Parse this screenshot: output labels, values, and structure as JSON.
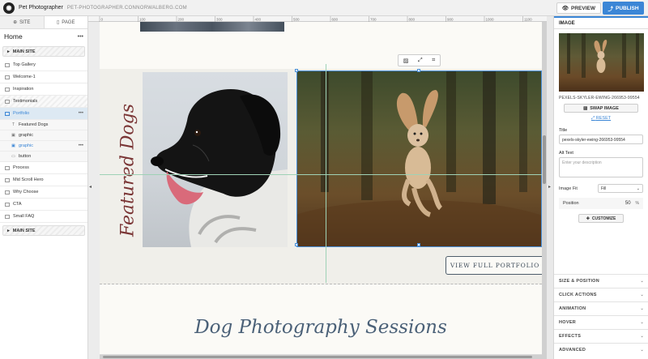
{
  "topbar": {
    "site_name": "Pet Photographer",
    "site_url": "PET-PHOTOGRAPHER.CONNORWALBERG.COM",
    "preview_label": "PREVIEW",
    "publish_label": "PUBLISH"
  },
  "sidebar": {
    "tabs": [
      {
        "label": "SITE"
      },
      {
        "label": "PAGE"
      }
    ],
    "page_title": "Home",
    "main_site_label": "MAIN SITE",
    "items": [
      {
        "label": "Top Gallery"
      },
      {
        "label": "Welcome-1"
      },
      {
        "label": "Inspiration"
      },
      {
        "label": "Testimonials"
      },
      {
        "label": "Portfolio"
      },
      {
        "label": "Featured Dogs"
      },
      {
        "label": "graphic"
      },
      {
        "label": "graphic"
      },
      {
        "label": "button"
      },
      {
        "label": "Process"
      },
      {
        "label": "Mid Scroll Hero"
      },
      {
        "label": "Why Choose"
      },
      {
        "label": "CTA"
      },
      {
        "label": "Small FAQ"
      }
    ],
    "footer_main_site_label": "MAIN SITE"
  },
  "ruler": [
    "0",
    "100",
    "200",
    "300",
    "400",
    "500",
    "600",
    "700",
    "800",
    "900",
    "1000",
    "1100",
    "1200"
  ],
  "canvas": {
    "featured_title": "Featured Dogs",
    "view_button": "VIEW FULL PORTFOLIO",
    "sessions_title": "Dog Photography Sessions"
  },
  "panel": {
    "header": "IMAGE",
    "filename": "PEXELS-SKYLER-EWING-266953-99554",
    "swap_label": "SWAP IMAGE",
    "reset_label": "RESET",
    "title_label": "Title",
    "title_value": "pexels-skyler-ewing-266953-99554",
    "alt_label": "Alt Text",
    "alt_placeholder": "Enter your description",
    "fit_label": "Image Fit",
    "fit_value": "Fill",
    "position_label": "Position",
    "position_value": "50",
    "position_unit": "%",
    "customize_label": "CUSTOMIZE",
    "sections": [
      "SIZE & POSITION",
      "CLICK ACTIONS",
      "ANIMATION",
      "HOVER",
      "EFFECTS",
      "ADVANCED"
    ]
  },
  "colors": {
    "accent": "#3b86d6",
    "featured_title": "#7a3535",
    "sessions_title": "#4b6178"
  }
}
